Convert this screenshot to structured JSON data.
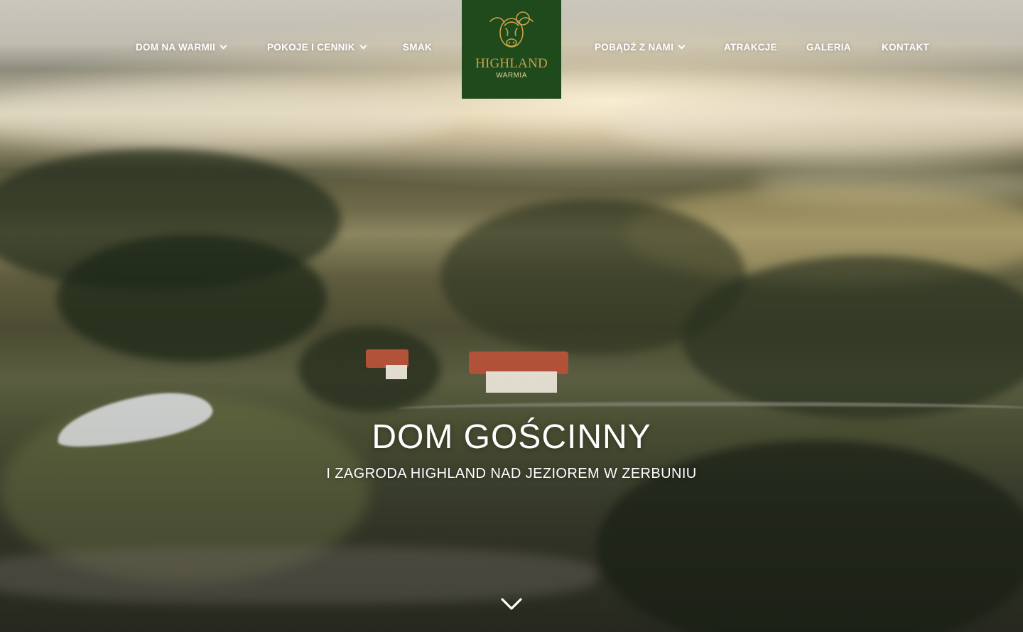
{
  "nav": {
    "left": [
      {
        "label": "DOM NA WARMII",
        "has_dropdown": true
      },
      {
        "label": "POKOJE I CENNIK",
        "has_dropdown": true
      },
      {
        "label": "SMAK",
        "has_dropdown": false
      }
    ],
    "right": [
      {
        "label": "POBĄDŹ Z NAMI",
        "has_dropdown": true
      },
      {
        "label": "ATRAKCJE",
        "has_dropdown": false
      },
      {
        "label": "GALERIA",
        "has_dropdown": false
      },
      {
        "label": "KONTAKT",
        "has_dropdown": false
      }
    ]
  },
  "logo": {
    "title": "HIGHLAND",
    "subtitle": "WARMIA",
    "icon": "highland-cow-icon",
    "background_color": "#1e4a1c",
    "text_color": "#c9a14a"
  },
  "hero": {
    "title": "DOM GOŚCINNY",
    "subtitle": "I ZAGRODA HIGHLAND NAD JEZIOREM W ZERBUNIU",
    "scroll_icon": "chevron-down-icon"
  }
}
